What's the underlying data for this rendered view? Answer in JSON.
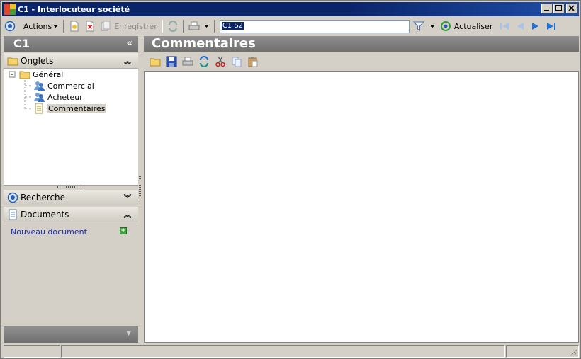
{
  "window": {
    "title": "C1 -  Interlocuteur société"
  },
  "toolbar": {
    "actions_label": "Actions",
    "save_label": "Enregistrer",
    "search_value": "C1 S2",
    "refresh_label": "Actualiser"
  },
  "left": {
    "header": "C1",
    "tabs_section": "Onglets",
    "tree": {
      "root": "Général",
      "items": [
        "Commercial",
        "Acheteur",
        "Commentaires"
      ]
    },
    "search_section": "Recherche",
    "documents_section": "Documents",
    "new_document": "Nouveau document"
  },
  "right": {
    "header": "Commentaires"
  },
  "colors": {
    "titlebar": "#0a246a",
    "panel_header": "#7f7f7f",
    "link": "#1a2fb0",
    "nav_blue": "#1f73d6"
  }
}
